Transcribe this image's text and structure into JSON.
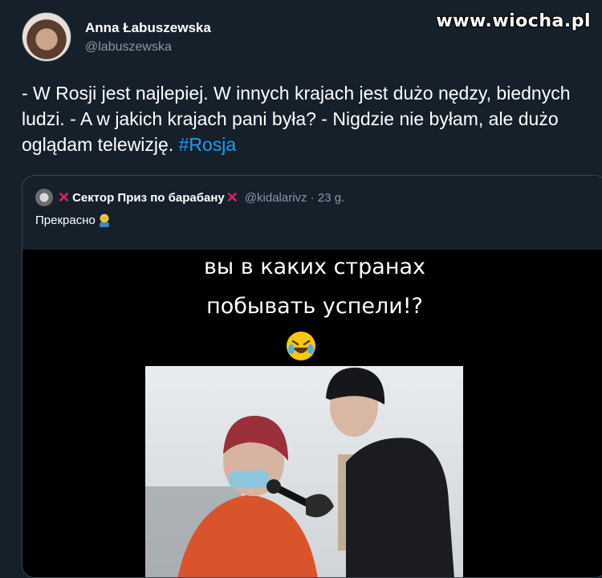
{
  "watermark": "www.wiocha.pl",
  "tweet": {
    "author_name": "Anna Łabuszewska",
    "author_handle": "@labuszewska",
    "text": "- W Rosji jest najlepiej. W innych krajach jest dużo nędzy, biednych ludzi. - A w jakich krajach pani była? - Nigdzie nie byłam, ale dużo oglądam telewizję. ",
    "hashtag": "#Rosja"
  },
  "quoted_tweet": {
    "author_name": "Сектор Приз по барабану",
    "handle_time": "@kidalarivz · 23 g.",
    "text": "Прекрасно",
    "video": {
      "caption_line1": "вы в каких странах",
      "caption_line2": "побывать успели!?"
    }
  },
  "colors": {
    "background": "#15202b",
    "secondary_text": "#8899a6",
    "link": "#1d9bf0",
    "border": "#38444d"
  },
  "icons": [
    "avatar-photo",
    "cross-mark-icon",
    "facepalm-emoji-icon",
    "rolling-laughing-emoji-icon"
  ]
}
